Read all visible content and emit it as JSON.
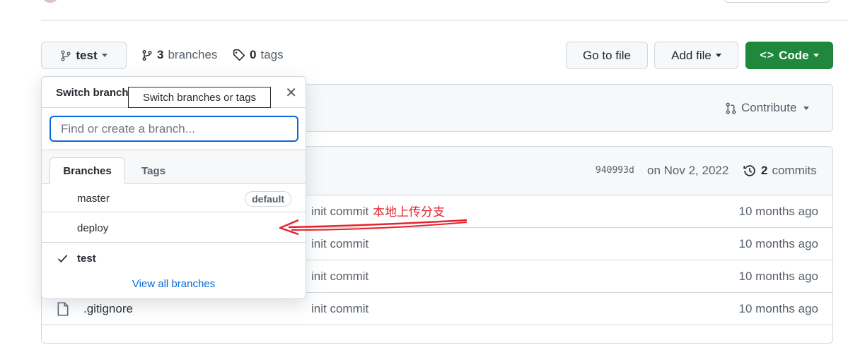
{
  "branch_button": {
    "label": "test"
  },
  "meta": {
    "branches_count": "3",
    "branches_label": "branches",
    "tags_count": "0",
    "tags_label": "tags"
  },
  "actions": {
    "go_to_file": "Go to file",
    "add_file": "Add file",
    "code": "Code"
  },
  "contribute": {
    "label": "Contribute"
  },
  "commit_bar": {
    "sha": "940993d",
    "date": "on Nov 2, 2022",
    "commits_count": "2",
    "commits_label": "commits"
  },
  "files": [
    {
      "name": "",
      "message": "init commit",
      "age": "10 months ago"
    },
    {
      "name": "",
      "message": "init commit",
      "age": "10 months ago"
    },
    {
      "name": "",
      "message": "init commit",
      "age": "10 months ago"
    },
    {
      "name": ".gitignore",
      "message": "init commit",
      "age": "10 months ago"
    }
  ],
  "dropdown": {
    "title": "Switch branches/tags",
    "search_placeholder": "Find or create a branch...",
    "tabs": [
      "Branches",
      "Tags"
    ],
    "branches": [
      {
        "name": "master",
        "badge": "default",
        "selected": false
      },
      {
        "name": "deploy",
        "badge": "",
        "selected": false
      },
      {
        "name": "test",
        "badge": "",
        "selected": true
      }
    ],
    "view_all": "View all branches"
  },
  "tooltip": {
    "text": "Switch branches or tags"
  },
  "annotation": {
    "text": "本地上传分支",
    "color": "#e5222d"
  },
  "colors": {
    "accent": "#0969da",
    "green": "#1f883d",
    "border": "#d0d7de"
  }
}
